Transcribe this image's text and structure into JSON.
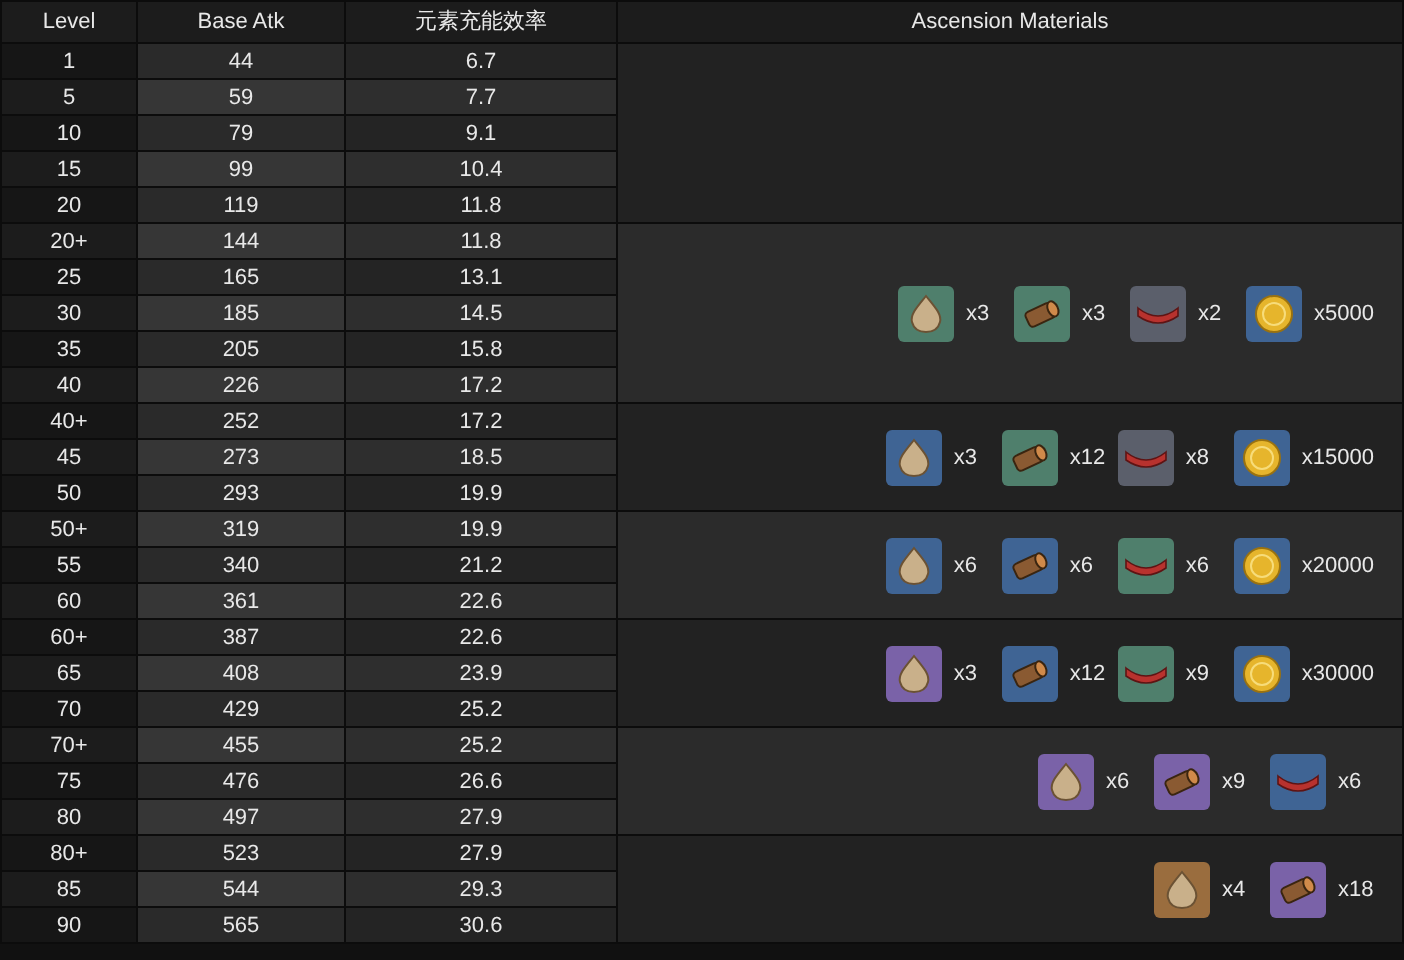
{
  "columns": [
    "Level",
    "Base Atk",
    "元素充能效率",
    "Ascension Materials"
  ],
  "groups": [
    {
      "rows": [
        {
          "level": "1",
          "base_atk": "44",
          "stat": "6.7"
        },
        {
          "level": "5",
          "base_atk": "59",
          "stat": "7.7"
        },
        {
          "level": "10",
          "base_atk": "79",
          "stat": "9.1"
        },
        {
          "level": "15",
          "base_atk": "99",
          "stat": "10.4"
        },
        {
          "level": "20",
          "base_atk": "119",
          "stat": "11.8"
        }
      ]
    },
    {
      "rows": [
        {
          "level": "20+",
          "base_atk": "144",
          "stat": "11.8"
        },
        {
          "level": "25",
          "base_atk": "165",
          "stat": "13.1"
        },
        {
          "level": "30",
          "base_atk": "185",
          "stat": "14.5"
        },
        {
          "level": "35",
          "base_atk": "205",
          "stat": "15.8"
        },
        {
          "level": "40",
          "base_atk": "226",
          "stat": "17.2"
        }
      ],
      "materials": [
        {
          "kind": "gem",
          "color": "#4f7f6c",
          "count": "x3"
        },
        {
          "kind": "scroll",
          "color": "#4f7f6c",
          "count": "x3"
        },
        {
          "kind": "ribbon",
          "color": "#5b5f6b",
          "count": "x2"
        },
        {
          "kind": "coin",
          "color": "#3f6494",
          "count": "x5000"
        }
      ]
    },
    {
      "rows": [
        {
          "level": "40+",
          "base_atk": "252",
          "stat": "17.2"
        },
        {
          "level": "45",
          "base_atk": "273",
          "stat": "18.5"
        },
        {
          "level": "50",
          "base_atk": "293",
          "stat": "19.9"
        }
      ],
      "materials": [
        {
          "kind": "gem",
          "color": "#3f6494",
          "count": "x3"
        },
        {
          "kind": "scroll",
          "color": "#4f7f6c",
          "count": "x12"
        },
        {
          "kind": "ribbon",
          "color": "#5b5f6b",
          "count": "x8"
        },
        {
          "kind": "coin",
          "color": "#3f6494",
          "count": "x15000"
        }
      ]
    },
    {
      "rows": [
        {
          "level": "50+",
          "base_atk": "319",
          "stat": "19.9"
        },
        {
          "level": "55",
          "base_atk": "340",
          "stat": "21.2"
        },
        {
          "level": "60",
          "base_atk": "361",
          "stat": "22.6"
        }
      ],
      "materials": [
        {
          "kind": "gem",
          "color": "#3f6494",
          "count": "x6"
        },
        {
          "kind": "scroll",
          "color": "#3f6494",
          "count": "x6"
        },
        {
          "kind": "ribbon",
          "color": "#4f7f6c",
          "count": "x6"
        },
        {
          "kind": "coin",
          "color": "#3f6494",
          "count": "x20000"
        }
      ]
    },
    {
      "rows": [
        {
          "level": "60+",
          "base_atk": "387",
          "stat": "22.6"
        },
        {
          "level": "65",
          "base_atk": "408",
          "stat": "23.9"
        },
        {
          "level": "70",
          "base_atk": "429",
          "stat": "25.2"
        }
      ],
      "materials": [
        {
          "kind": "gem",
          "color": "#7a62a8",
          "count": "x3"
        },
        {
          "kind": "scroll",
          "color": "#3f6494",
          "count": "x12"
        },
        {
          "kind": "ribbon",
          "color": "#4f7f6c",
          "count": "x9"
        },
        {
          "kind": "coin",
          "color": "#3f6494",
          "count": "x30000"
        }
      ]
    },
    {
      "rows": [
        {
          "level": "70+",
          "base_atk": "455",
          "stat": "25.2"
        },
        {
          "level": "75",
          "base_atk": "476",
          "stat": "26.6"
        },
        {
          "level": "80",
          "base_atk": "497",
          "stat": "27.9"
        }
      ],
      "materials": [
        {
          "kind": "gem",
          "color": "#7a62a8",
          "count": "x6"
        },
        {
          "kind": "scroll",
          "color": "#7a62a8",
          "count": "x9"
        },
        {
          "kind": "ribbon",
          "color": "#3f6494",
          "count": "x6"
        }
      ]
    },
    {
      "rows": [
        {
          "level": "80+",
          "base_atk": "523",
          "stat": "27.9"
        },
        {
          "level": "85",
          "base_atk": "544",
          "stat": "29.3"
        },
        {
          "level": "90",
          "base_atk": "565",
          "stat": "30.6"
        }
      ],
      "materials": [
        {
          "kind": "gem",
          "color": "#9a6d3e",
          "count": "x4"
        },
        {
          "kind": "scroll",
          "color": "#7a62a8",
          "count": "x18"
        }
      ]
    }
  ]
}
